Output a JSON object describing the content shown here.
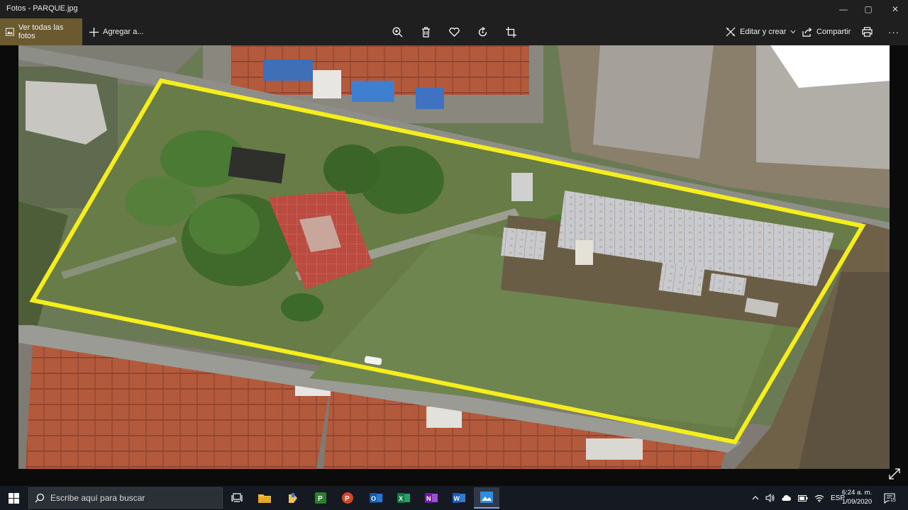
{
  "window": {
    "title": "Fotos - PARQUE.jpg",
    "minimize_symbol": "—",
    "maximize_symbol": "▢",
    "close_symbol": "✕"
  },
  "toolbar": {
    "see_all_label": "Ver todas las fotos",
    "add_label": "Agregar a...",
    "edit_create_label": "Editar y crear",
    "share_label": "Compartir",
    "more_symbol": "···",
    "icons": [
      "zoom-icon",
      "delete-icon",
      "favorite-icon",
      "rotate-icon",
      "crop-icon",
      "print-icon"
    ]
  },
  "photo": {
    "filename": "PARQUE.jpg",
    "boundary_color": "#f5ee1c",
    "colors": {
      "grass": "#6b7d4a",
      "grass_dark": "#556a3a",
      "roof_red": "#b5593d",
      "court": "#b8493e",
      "road": "#8c8c86",
      "roof_metal": "#c9cbcd",
      "dirt": "#7d6e55"
    }
  },
  "taskbar": {
    "search_placeholder": "Escribe aquí para buscar",
    "apps": [
      "task-view-icon",
      "file-explorer-icon",
      "project-icon",
      "powerpoint-icon",
      "outlook-icon",
      "excel-icon",
      "onenote-icon",
      "word-icon",
      "photos-icon"
    ],
    "language": "ESP",
    "time": "6:24 a. m.",
    "date": "1/09/2020",
    "notification_count": "15"
  }
}
